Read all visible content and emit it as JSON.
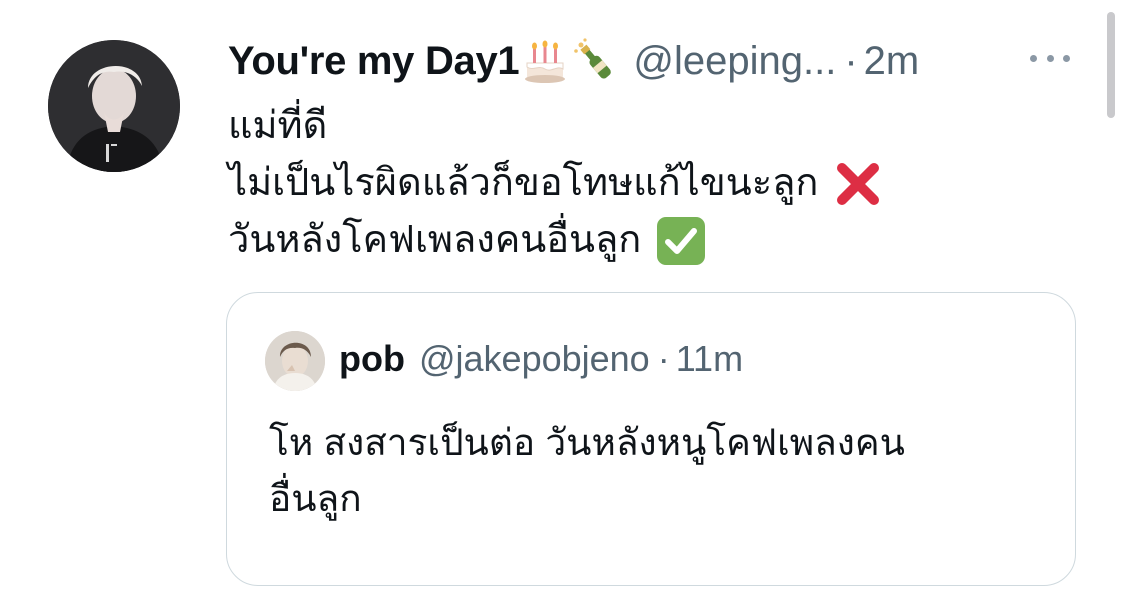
{
  "tweet": {
    "display_name": "You're my Day1",
    "display_name_emojis": [
      "birthday-cake-emoji",
      "champagne-bottle-emoji"
    ],
    "handle": "@leeping...",
    "separator": "·",
    "time": "2m",
    "lines": [
      "แม่ที่ดี",
      "ไม่เป็นไรผิดแล้วก็ขอโทษแก้ไขนะลูก",
      "วันหลังโคฟเพลงคนอื่นลูก"
    ],
    "line_marks": [
      "",
      "cross-mark-emoji",
      "check-mark-emoji"
    ]
  },
  "quoted_tweet": {
    "display_name": "pob",
    "handle": "@jakepobjeno",
    "separator": "·",
    "time": "11m",
    "text_lines": [
      "โห สงสารเป็นต่อ วันหลังหนูโคฟเพลงคน",
      "อื่นลูก"
    ]
  },
  "colors": {
    "text_primary": "#0f1419",
    "text_secondary": "#536471",
    "border": "#cfd9de",
    "cross_red": "#dd2e44",
    "check_green": "#77b255"
  }
}
